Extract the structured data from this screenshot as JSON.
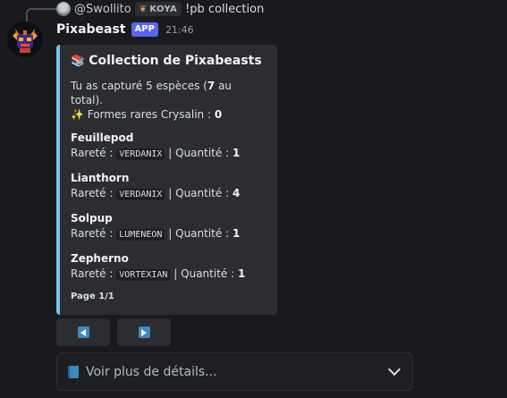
{
  "reply": {
    "username": "@Swollito",
    "tag": "KOYA",
    "command": "!pb collection"
  },
  "message": {
    "author": "Pixabeast",
    "badge": "APP",
    "time": "21:46"
  },
  "embed": {
    "title_icon": "books-icon",
    "title": "Collection de Pixabeasts",
    "desc_prefix": "Tu as capturé 5 espèces (",
    "desc_total": "7",
    "desc_suffix": " au total).",
    "rare_icon": "✨",
    "rare_label": "Formes rares Crysalin : ",
    "rare_count": "0",
    "accent_color": "#79c4ea",
    "fields": [
      {
        "name": "Feuillepod",
        "rarity_label": "Rareté :",
        "rarity": "VERDANIX",
        "qty_label": "| Quantité :",
        "qty": "1"
      },
      {
        "name": "Lianthorn",
        "rarity_label": "Rareté :",
        "rarity": "VERDANIX",
        "qty_label": "| Quantité :",
        "qty": "4"
      },
      {
        "name": "Solpup",
        "rarity_label": "Rareté :",
        "rarity": "LUMENEON",
        "qty_label": "| Quantité :",
        "qty": "1"
      },
      {
        "name": "Zepherno",
        "rarity_label": "Rareté :",
        "rarity": "VORTEXIAN",
        "qty_label": "| Quantité :",
        "qty": "1"
      }
    ],
    "footer": "Page 1/1"
  },
  "buttons": {
    "prev_icon": "arrow-left-icon",
    "next_icon": "arrow-right-icon"
  },
  "select": {
    "icon": "blue-book-icon",
    "placeholder": "Voir plus de détails..."
  }
}
